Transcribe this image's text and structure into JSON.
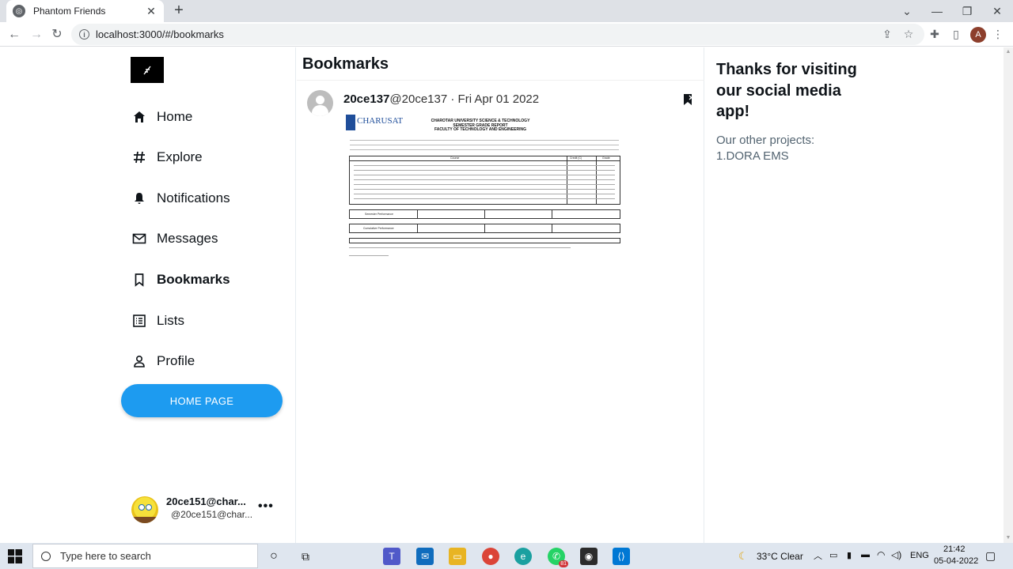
{
  "browser": {
    "tab_title": "Phantom Friends",
    "tab_close": "✕",
    "new_tab": "+",
    "url": "localhost:3000/#/bookmarks",
    "profile_initial": "A"
  },
  "sidebar": {
    "nav": [
      {
        "label": "Home",
        "icon": "home-icon"
      },
      {
        "label": "Explore",
        "icon": "hash-icon"
      },
      {
        "label": "Notifications",
        "icon": "bell-icon"
      },
      {
        "label": "Messages",
        "icon": "mail-icon"
      },
      {
        "label": "Bookmarks",
        "icon": "bookmark-icon",
        "active": true
      },
      {
        "label": "Lists",
        "icon": "list-icon"
      },
      {
        "label": "Profile",
        "icon": "person-icon"
      }
    ],
    "home_button": "HOME PAGE",
    "user": {
      "name": "20ce151@char...",
      "handle": "@20ce151@char...",
      "more": "•••"
    }
  },
  "main": {
    "title": "Bookmarks",
    "post": {
      "name": "20ce137",
      "handle": "@20ce137",
      "separator": " · ",
      "date": "Fri Apr 01 2022",
      "image": {
        "logo_text": "CHARUSAT",
        "heading_1": "CHAROTAR UNIVERSITY SCIENCE & TECHNOLOGY",
        "heading_2": "SEMESTER GRADE REPORT",
        "heading_3": "FACULTY OF TECHNOLOGY AND ENGINEERING",
        "col_course": "Course",
        "col_credit": "Credit (C)",
        "col_grade": "Grade",
        "semester_performance": "Semester Performance",
        "cumulative_performance": "Cumulative Performance"
      }
    }
  },
  "right": {
    "title": "Thanks for visiting our social media app!",
    "subtitle": "Our other projects:",
    "project": "1.DORA EMS"
  },
  "taskbar": {
    "search_placeholder": "Type here to search",
    "weather": "33°C  Clear",
    "language": "ENG",
    "time": "21:42",
    "date": "05-04-2022",
    "whatsapp_badge": "81"
  }
}
